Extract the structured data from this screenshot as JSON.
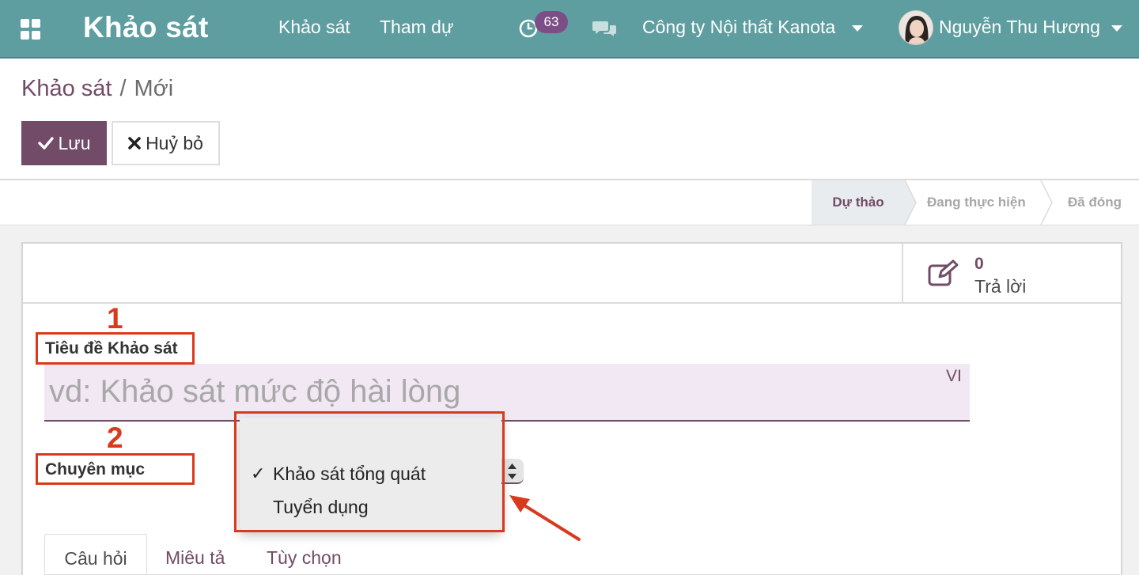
{
  "navbar": {
    "brand": "Khảo sát",
    "links": [
      "Khảo sát",
      "Tham dự"
    ],
    "activity_count": "63",
    "company": "Công ty Nội thất Kanota",
    "user_name": "Nguyễn Thu Hương",
    "colors": {
      "bar": "#5e9ea0",
      "badge": "#7c4d86"
    }
  },
  "breadcrumb": {
    "parent": "Khảo sát",
    "separator": "/",
    "current": "Mới"
  },
  "buttons": {
    "save": "Lưu",
    "discard": "Huỷ bỏ"
  },
  "statusbar": {
    "stages": [
      "Dự thảo",
      "Đang thực hiện",
      "Đã đóng"
    ],
    "active": "Dự thảo"
  },
  "stat_button": {
    "value": "0",
    "label": "Trả lời"
  },
  "form": {
    "title_label": "Tiêu đề Khảo sát",
    "title_placeholder": "vd: Khảo sát mức độ hài lòng",
    "lang": "VI",
    "category_label": "Chuyên mục",
    "category_options": [
      "Khảo sát tổng quát",
      "Tuyển dụng"
    ],
    "category_selected": "Khảo sát tổng quát"
  },
  "tabs": [
    "Câu hỏi",
    "Miêu tả",
    "Tùy chọn"
  ],
  "annotations": {
    "num1": "1",
    "num2": "2",
    "color": "#d9391c"
  },
  "accent_color": "#714b67"
}
